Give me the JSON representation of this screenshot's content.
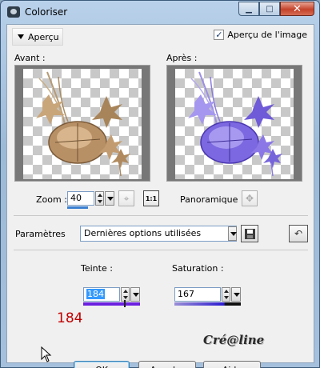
{
  "window": {
    "title": "Coloriser"
  },
  "preview_section": {
    "toggle_label": "Aperçu",
    "image_preview_label": "Aperçu de l'image",
    "image_preview_checked": true,
    "before_label": "Avant :",
    "after_label": "Après :"
  },
  "zoom": {
    "label": "Zoom :",
    "value": "40"
  },
  "pan": {
    "label": "Panoramique :"
  },
  "one_to_one_label": "1:1",
  "params": {
    "label": "Paramètres",
    "selected": "Dernières options utilisées"
  },
  "hue": {
    "label": "Teinte :",
    "value": "184",
    "annotation": "184"
  },
  "saturation": {
    "label": "Saturation :",
    "value": "167"
  },
  "watermark": "Cré@line",
  "buttons": {
    "ok": "OK",
    "cancel": "Annuler",
    "help": "Aide"
  },
  "colors": {
    "hue_bar": "#6a1fe0",
    "sat_bar_start": "#9a8fd6",
    "sat_bar_end": "#2b1bd0",
    "annotation": "#c00000"
  }
}
